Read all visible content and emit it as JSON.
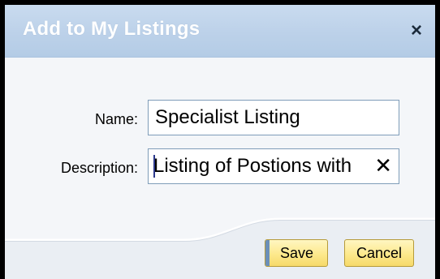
{
  "dialog": {
    "title": "Add to My Listings",
    "close_label": "×"
  },
  "form": {
    "name_label": "Name:",
    "name_value": "Specialist Listing",
    "description_label": "Description:",
    "description_value": "Listing of Postions with",
    "clear_label": "✕"
  },
  "buttons": {
    "save_label": "Save",
    "cancel_label": "Cancel"
  },
  "colors": {
    "titlebar": "#bcd1e9",
    "button_fill": "#fde98c",
    "button_border": "#b69b3a",
    "save_accent": "#6b8fb8"
  },
  "icons": {
    "close": "close-icon",
    "clear": "clear-icon"
  }
}
